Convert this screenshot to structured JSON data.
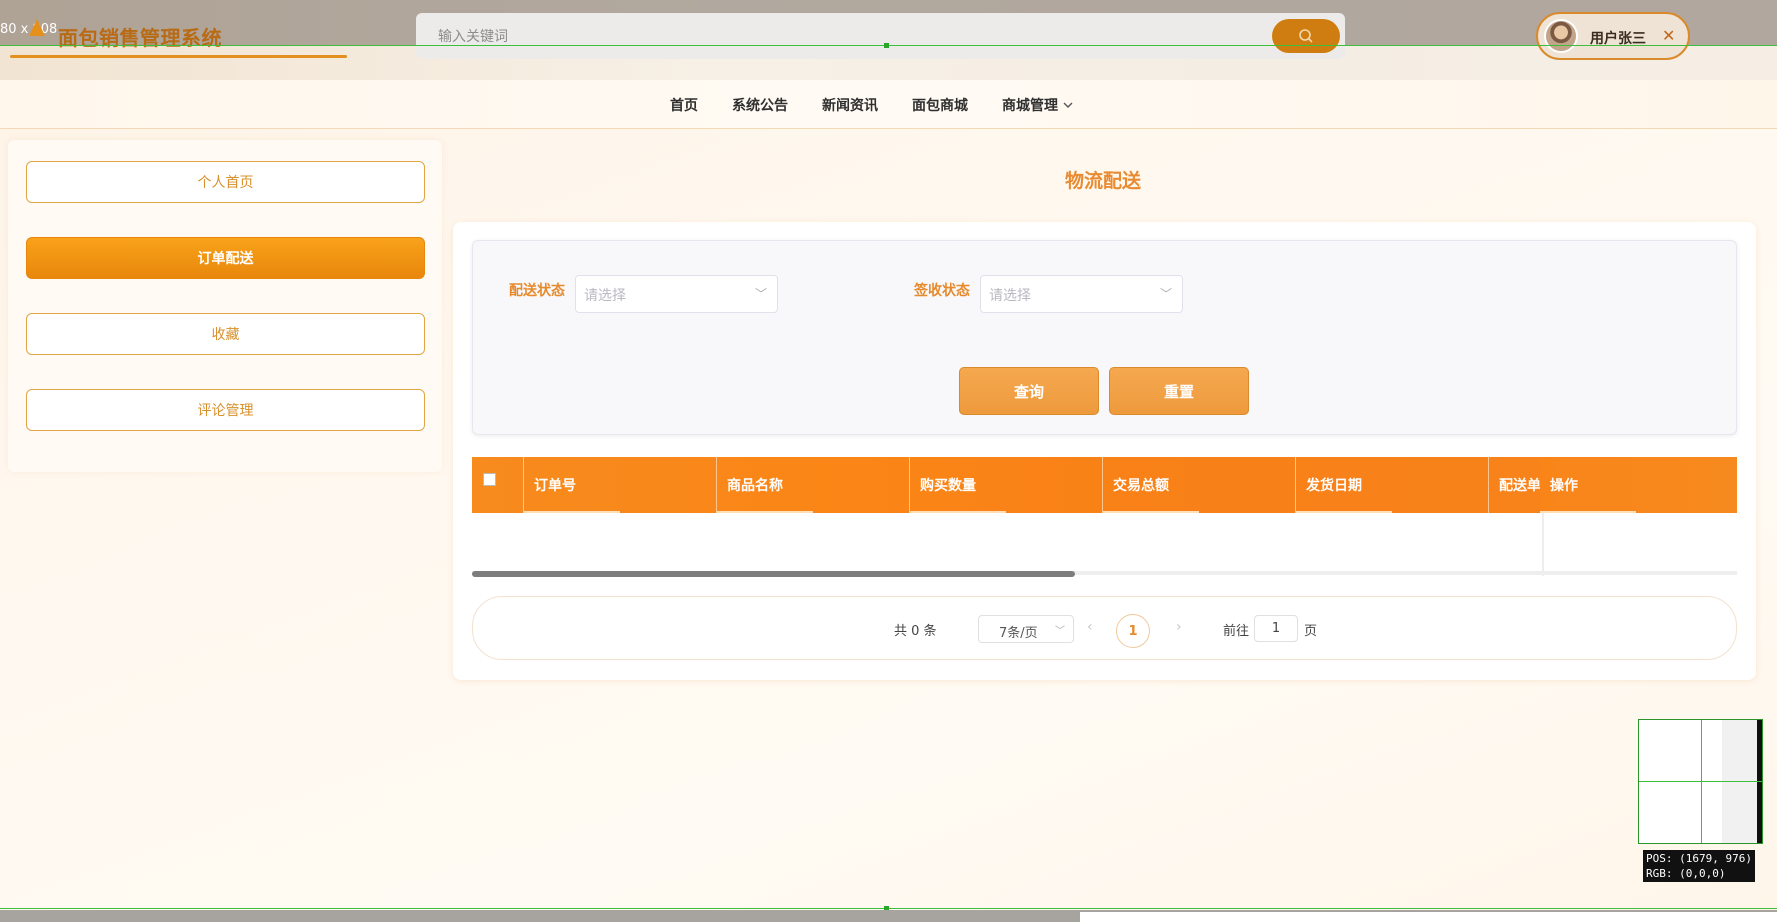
{
  "overlay": {
    "resolution_label": "80 x 808"
  },
  "header": {
    "logo_text": "面包销售管理系统",
    "search_placeholder": "输入关键词",
    "user_name": "用户张三"
  },
  "nav": {
    "items": [
      "首页",
      "系统公告",
      "新闻资讯",
      "面包商城",
      "商城管理"
    ]
  },
  "sidebar": {
    "items": [
      {
        "label": "个人首页",
        "active": false
      },
      {
        "label": "订单配送",
        "active": true
      },
      {
        "label": "收藏",
        "active": false
      },
      {
        "label": "评论管理",
        "active": false
      }
    ]
  },
  "main": {
    "title": "物流配送",
    "filters": {
      "delivery_status_label": "配送状态",
      "delivery_status_placeholder": "请选择",
      "sign_status_label": "签收状态",
      "sign_status_placeholder": "请选择"
    },
    "buttons": {
      "query": "查询",
      "reset": "重置"
    },
    "table": {
      "columns": [
        "订单号",
        "商品名称",
        "购买数量",
        "交易总额",
        "发货日期",
        "配送单号",
        "操作"
      ],
      "rows": []
    },
    "pagination": {
      "total_text": "共 0 条",
      "page_size": "7条/页",
      "current_page": "1",
      "goto_label": "前往",
      "goto_value": "1",
      "page_suffix": "页"
    }
  },
  "magnifier": {
    "pos_text": "POS: (1679, 976)",
    "rgb_text": "RGB: (0,0,0)"
  },
  "colors": {
    "accent": "#f78b1e",
    "accent_text": "#e68a2b",
    "active_button": "#f39414"
  }
}
